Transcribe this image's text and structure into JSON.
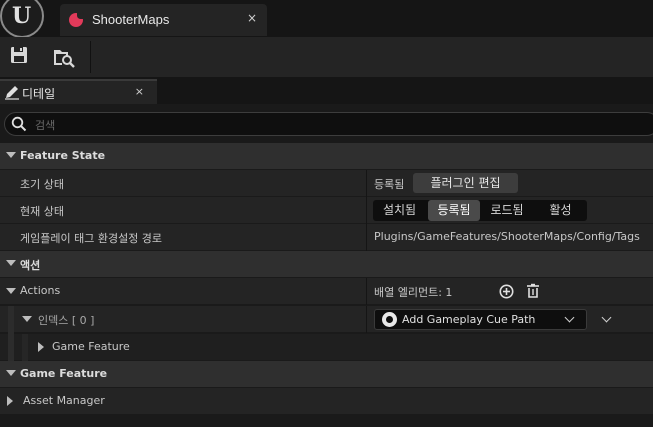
{
  "document_tab": {
    "title": "ShooterMaps",
    "close": "×"
  },
  "toolbar": {
    "buttons": [
      {
        "name": "save",
        "icon": "save-icon"
      },
      {
        "name": "browse",
        "icon": "folder-search-icon"
      }
    ]
  },
  "details_tab": {
    "title": "디테일",
    "icon": "pencil-icon",
    "close": "×"
  },
  "search": {
    "placeholder": "검색"
  },
  "sections": {
    "feature_state": {
      "title": "Feature State",
      "initial_state": {
        "label": "초기 상태",
        "value": "등록됨",
        "button": "플러그인 편집"
      },
      "current_state": {
        "label": "현재 상태",
        "options": [
          "설치됨",
          "등록됨",
          "로드됨",
          "활성"
        ],
        "selected": "등록됨"
      },
      "config_path": {
        "label": "게임플레이 태그 환경설정 경로",
        "value": "Plugins/GameFeatures/ShooterMaps/Config/Tags"
      }
    },
    "actions_section": {
      "title": "액션",
      "actions": {
        "label": "Actions",
        "count_label": "배열 엘리먼트: 1"
      },
      "index0": {
        "label": "인덱스 [ 0 ]",
        "dropdown": "Add Gameplay Cue Path"
      },
      "game_feature_child": {
        "label": "Game Feature"
      }
    },
    "game_feature": {
      "title": "Game Feature",
      "asset_manager": {
        "label": "Asset Manager"
      }
    }
  },
  "colors": {
    "accent_tab_icon": "#e23a5a",
    "panel_bg": "#242424",
    "section_bg": "#2f2f2f"
  }
}
